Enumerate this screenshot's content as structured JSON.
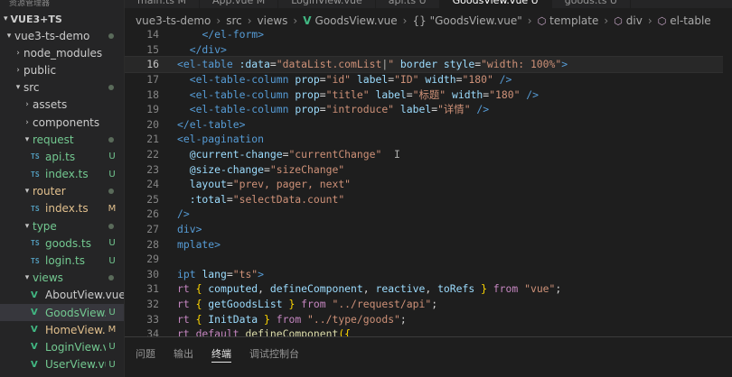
{
  "tabs": [
    {
      "label": "main.ts  M",
      "active": false
    },
    {
      "label": "App.vue  M",
      "active": false
    },
    {
      "label": "LoginView.vue",
      "active": false
    },
    {
      "label": "api.ts  U",
      "active": false
    },
    {
      "label": "GoodsView.vue  U",
      "active": true
    },
    {
      "label": "goods.ts  U",
      "active": false
    }
  ],
  "sidebar": {
    "top_label": "资源管理器",
    "project": "VUE3+TS",
    "items": [
      {
        "label": "vue3-ts-demo",
        "indent": 0,
        "kind": "folder-open",
        "status": "dot",
        "color": "plain"
      },
      {
        "label": "node_modules",
        "indent": 1,
        "kind": "folder",
        "status": "",
        "color": "plain"
      },
      {
        "label": "public",
        "indent": 1,
        "kind": "folder",
        "status": "",
        "color": "plain"
      },
      {
        "label": "src",
        "indent": 1,
        "kind": "folder-open",
        "status": "dot",
        "color": "plain"
      },
      {
        "label": "assets",
        "indent": 2,
        "kind": "folder",
        "status": "",
        "color": "plain"
      },
      {
        "label": "components",
        "indent": 2,
        "kind": "folder",
        "status": "",
        "color": "plain"
      },
      {
        "label": "request",
        "indent": 2,
        "kind": "folder-open",
        "status": "dot",
        "color": "green"
      },
      {
        "label": "api.ts",
        "indent": 3,
        "kind": "ts",
        "status": "U",
        "color": "green"
      },
      {
        "label": "index.ts",
        "indent": 3,
        "kind": "ts",
        "status": "U",
        "color": "green"
      },
      {
        "label": "router",
        "indent": 2,
        "kind": "folder-open",
        "status": "dot",
        "color": "orange"
      },
      {
        "label": "index.ts",
        "indent": 3,
        "kind": "ts",
        "status": "M",
        "color": "orange"
      },
      {
        "label": "type",
        "indent": 2,
        "kind": "folder-open",
        "status": "dot",
        "color": "green"
      },
      {
        "label": "goods.ts",
        "indent": 3,
        "kind": "ts",
        "status": "U",
        "color": "green"
      },
      {
        "label": "login.ts",
        "indent": 3,
        "kind": "ts",
        "status": "U",
        "color": "green"
      },
      {
        "label": "views",
        "indent": 2,
        "kind": "folder-open",
        "status": "dot",
        "color": "green"
      },
      {
        "label": "AboutView.vue",
        "indent": 3,
        "kind": "vue",
        "status": "",
        "color": "plain"
      },
      {
        "label": "GoodsView...",
        "indent": 3,
        "kind": "vue",
        "status": "U",
        "color": "green",
        "selected": true
      },
      {
        "label": "HomeView....",
        "indent": 3,
        "kind": "vue",
        "status": "M",
        "color": "orange"
      },
      {
        "label": "LoginView.vue",
        "indent": 3,
        "kind": "vue",
        "status": "U",
        "color": "green"
      },
      {
        "label": "UserView.vue",
        "indent": 3,
        "kind": "vue",
        "status": "U",
        "color": "green"
      }
    ]
  },
  "breadcrumb": [
    "vue3-ts-demo",
    "src",
    "views",
    "GoodsView.vue",
    "{} \"GoodsView.vue\"",
    "template",
    "div",
    "el-table"
  ],
  "editor": {
    "current_line": 16,
    "lines": [
      {
        "n": "14",
        "tokens": [
          [
            "    ",
            "plain"
          ],
          [
            "</el-form>",
            "tag"
          ]
        ]
      },
      {
        "n": "15",
        "tokens": [
          [
            "  ",
            "plain"
          ],
          [
            "</div>",
            "tag"
          ]
        ]
      },
      {
        "n": "16",
        "tokens": [
          [
            "<el-table ",
            "tag"
          ],
          [
            ":data",
            "attr"
          ],
          [
            "=",
            "plain"
          ],
          [
            "\"dataList.comList",
            "str"
          ],
          [
            "|",
            "cursor"
          ],
          [
            "\"",
            "str"
          ],
          [
            " border ",
            "attr"
          ],
          [
            "style",
            "attr"
          ],
          [
            "=",
            "plain"
          ],
          [
            "\"width: 100%\"",
            "str"
          ],
          [
            ">",
            "tag"
          ]
        ]
      },
      {
        "n": "17",
        "tokens": [
          [
            "  <el-table-column ",
            "tag"
          ],
          [
            "prop",
            "attr"
          ],
          [
            "=",
            "plain"
          ],
          [
            "\"id\"",
            "str"
          ],
          [
            " label",
            "attr"
          ],
          [
            "=",
            "plain"
          ],
          [
            "\"ID\"",
            "str"
          ],
          [
            " width",
            "attr"
          ],
          [
            "=",
            "plain"
          ],
          [
            "\"180\"",
            "str"
          ],
          [
            " />",
            "tag"
          ]
        ]
      },
      {
        "n": "18",
        "tokens": [
          [
            "  <el-table-column ",
            "tag"
          ],
          [
            "prop",
            "attr"
          ],
          [
            "=",
            "plain"
          ],
          [
            "\"title\"",
            "str"
          ],
          [
            " label",
            "attr"
          ],
          [
            "=",
            "plain"
          ],
          [
            "\"标题\"",
            "str"
          ],
          [
            " width",
            "attr"
          ],
          [
            "=",
            "plain"
          ],
          [
            "\"180\"",
            "str"
          ],
          [
            " />",
            "tag"
          ]
        ]
      },
      {
        "n": "19",
        "tokens": [
          [
            "  <el-table-column ",
            "tag"
          ],
          [
            "prop",
            "attr"
          ],
          [
            "=",
            "plain"
          ],
          [
            "\"introduce\"",
            "str"
          ],
          [
            " label",
            "attr"
          ],
          [
            "=",
            "plain"
          ],
          [
            "\"详情\"",
            "str"
          ],
          [
            " />",
            "tag"
          ]
        ]
      },
      {
        "n": "20",
        "tokens": [
          [
            "</el-table>",
            "tag"
          ]
        ]
      },
      {
        "n": "21",
        "tokens": [
          [
            "<el-pagination",
            "tag"
          ]
        ]
      },
      {
        "n": "22",
        "tokens": [
          [
            "  @current-change",
            "attr"
          ],
          [
            "=",
            "plain"
          ],
          [
            "\"currentChange\"",
            "str"
          ],
          [
            "  I",
            "cursor"
          ]
        ]
      },
      {
        "n": "23",
        "tokens": [
          [
            "  @size-change",
            "attr"
          ],
          [
            "=",
            "plain"
          ],
          [
            "\"sizeChange\"",
            "str"
          ]
        ]
      },
      {
        "n": "24",
        "tokens": [
          [
            "  layout",
            "attr"
          ],
          [
            "=",
            "plain"
          ],
          [
            "\"prev, pager, next\"",
            "str"
          ]
        ]
      },
      {
        "n": "25",
        "tokens": [
          [
            "  :total",
            "attr"
          ],
          [
            "=",
            "plain"
          ],
          [
            "\"selectData.count\"",
            "str"
          ]
        ]
      },
      {
        "n": "26",
        "tokens": [
          [
            "/>",
            "tag"
          ]
        ]
      },
      {
        "n": "27",
        "tokens": [
          [
            "div>",
            "tag"
          ]
        ]
      },
      {
        "n": "28",
        "tokens": [
          [
            "mplate>",
            "tag"
          ]
        ]
      },
      {
        "n": "29",
        "tokens": []
      },
      {
        "n": "30",
        "tokens": [
          [
            "ipt ",
            "tag"
          ],
          [
            "lang",
            "attr"
          ],
          [
            "=",
            "plain"
          ],
          [
            "\"ts\"",
            "str"
          ],
          [
            ">",
            "tag"
          ]
        ]
      },
      {
        "n": "31",
        "tokens": [
          [
            "rt ",
            "kw"
          ],
          [
            "{ ",
            "brace"
          ],
          [
            "computed",
            "var"
          ],
          [
            ", ",
            "plain"
          ],
          [
            "defineComponent",
            "var"
          ],
          [
            ", ",
            "plain"
          ],
          [
            "reactive",
            "var"
          ],
          [
            ", ",
            "plain"
          ],
          [
            "toRefs",
            "var"
          ],
          [
            " }",
            "brace"
          ],
          [
            " from ",
            "kw"
          ],
          [
            "\"vue\"",
            "str"
          ],
          [
            ";",
            "plain"
          ]
        ]
      },
      {
        "n": "32",
        "tokens": [
          [
            "rt ",
            "kw"
          ],
          [
            "{ ",
            "brace"
          ],
          [
            "getGoodsList",
            "var"
          ],
          [
            " }",
            "brace"
          ],
          [
            " from ",
            "kw"
          ],
          [
            "\"../request/api\"",
            "str"
          ],
          [
            ";",
            "plain"
          ]
        ]
      },
      {
        "n": "33",
        "tokens": [
          [
            "rt ",
            "kw"
          ],
          [
            "{ ",
            "brace"
          ],
          [
            "InitData",
            "var"
          ],
          [
            " }",
            "brace"
          ],
          [
            " from ",
            "kw"
          ],
          [
            "\"../type/goods\"",
            "str"
          ],
          [
            ";",
            "plain"
          ]
        ]
      },
      {
        "n": "34",
        "tokens": [
          [
            "rt ",
            "kw"
          ],
          [
            "default ",
            "kw"
          ],
          [
            "defineComponent",
            "fn"
          ],
          [
            "({",
            "brace"
          ]
        ]
      }
    ]
  },
  "panel": {
    "tabs": [
      {
        "label": "问题",
        "active": false
      },
      {
        "label": "输出",
        "active": false
      },
      {
        "label": "终端",
        "active": true
      },
      {
        "label": "调试控制台",
        "active": false
      }
    ]
  }
}
